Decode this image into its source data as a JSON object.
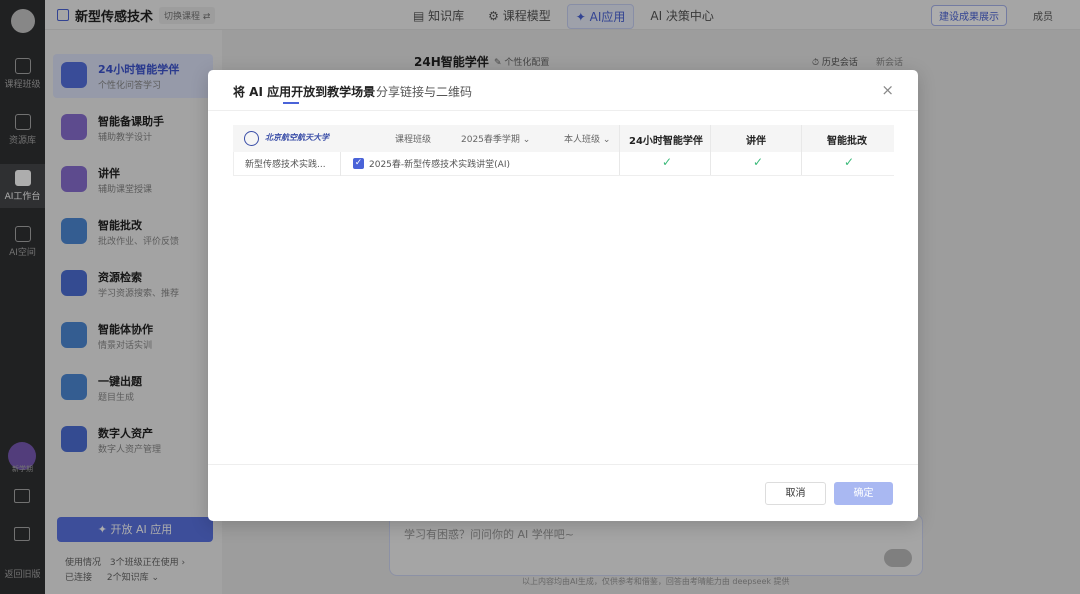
{
  "rail": {
    "items": [
      {
        "label": "课程班级",
        "icon": "class-icon"
      },
      {
        "label": "资源库",
        "icon": "library-icon"
      },
      {
        "label": "AI工作台",
        "icon": "ai-workbench-icon"
      },
      {
        "label": "AI空间",
        "icon": "ai-space-icon"
      }
    ],
    "avatar_label": "新学期",
    "back_label": "返回旧版"
  },
  "header": {
    "course_title": "新型传感技术",
    "switch_label": "切换课程 ⇄",
    "tabs": [
      {
        "label": "▤ 知识库",
        "active": false
      },
      {
        "label": "⚙ 课程模型",
        "active": false
      },
      {
        "label": "✦ AI应用",
        "active": true
      },
      {
        "label": "AI 决策中心",
        "active": false
      }
    ],
    "showcase_label": "建设成果展示",
    "member_label": "成员"
  },
  "apps": [
    {
      "name": "24小时智能学伴",
      "desc": "个性化问答学习",
      "active": true
    },
    {
      "name": "智能备课助手",
      "desc": "辅助教学设计",
      "active": false
    },
    {
      "name": "讲伴",
      "desc": "辅助课堂授课",
      "active": false
    },
    {
      "name": "智能批改",
      "desc": "批改作业、评价反馈",
      "active": false
    },
    {
      "name": "资源检索",
      "desc": "学习资源搜索、推荐",
      "active": false
    },
    {
      "name": "智能体协作",
      "desc": "情景对话实训",
      "active": false
    },
    {
      "name": "一键出题",
      "desc": "题目生成",
      "active": false
    },
    {
      "name": "数字人资产",
      "desc": "数字人资产管理",
      "active": false
    }
  ],
  "open_app_label": "✦ 开放 AI 应用",
  "usage": {
    "row1_label": "使用情况",
    "row1_value": "3个班级正在使用 ›",
    "row2_label": "已连接",
    "row2_value": "2个知识库 ⌄"
  },
  "chat": {
    "title": "24H智能学伴",
    "config_label": "✎ 个性化配置",
    "history_label": "⏱ 历史会话",
    "new_label": "新会话",
    "input_placeholder": "学习有困惑？问问你的 AI 学伴吧~",
    "disclaimer": "以上内容均由AI生成，仅供参考和借鉴，回答由考晴能力由 deepseek 提供"
  },
  "modal": {
    "tab_active": "将 AI 应用开放到教学场景",
    "tab_other": "分享链接与二维码",
    "close_label": "×",
    "table": {
      "university_name": "北京航空航天大学",
      "col_grade": "课程班级",
      "col_term": "2025春季学期 ⌄",
      "col_class": "本人班级 ⌄",
      "app_cols": [
        "24小时智能学伴",
        "讲伴",
        "智能批改"
      ],
      "rows": [
        {
          "course": "新型传感技术实践...",
          "class": "2025春-新型传感技术实践讲堂(AI)",
          "checked": true,
          "enabled": [
            true,
            true,
            true
          ]
        }
      ]
    },
    "cancel_label": "取消",
    "ok_label": "确定"
  },
  "colors": {
    "accent": "#4a63d8",
    "check": "#3cba7a",
    "rail": "#303133"
  }
}
